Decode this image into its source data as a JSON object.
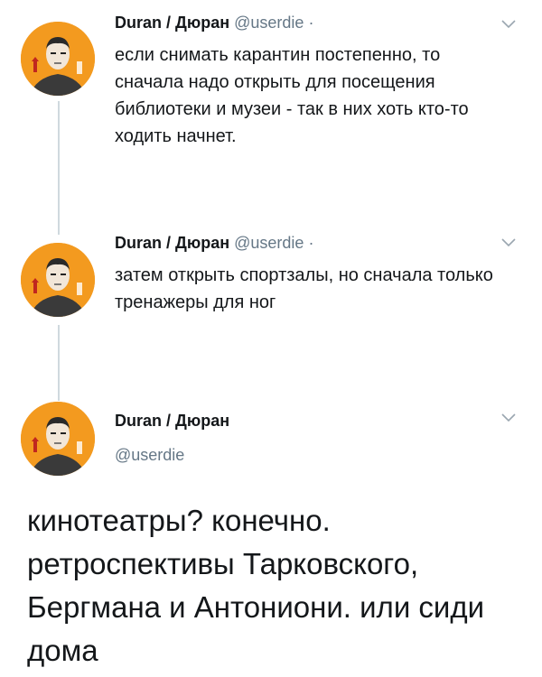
{
  "tweets": [
    {
      "author": "Duran / Дюран",
      "handle": "@userdie",
      "separator": "·",
      "text": "если снимать карантин постепенно, то сначала надо открыть для посещения библиотеки и музеи - так в них хоть кто-то ходить начнет."
    },
    {
      "author": "Duran / Дюран",
      "handle": "@userdie",
      "separator": "·",
      "text": "затем открыть спортзалы, но сначала только тренажеры для ног"
    }
  ],
  "main_tweet": {
    "author": "Duran / Дюран",
    "handle": "@userdie",
    "text": "кинотеатры? конечно. ретроспективы Тарковского, Бергмана и Антониони. или сиди дома"
  },
  "icons": {
    "avatar": "avatar-illustration",
    "menu": "chevron-down-icon"
  },
  "colors": {
    "avatar_bg": "#f39a1f",
    "handle": "#657786",
    "thread_line": "#cfd9de"
  }
}
